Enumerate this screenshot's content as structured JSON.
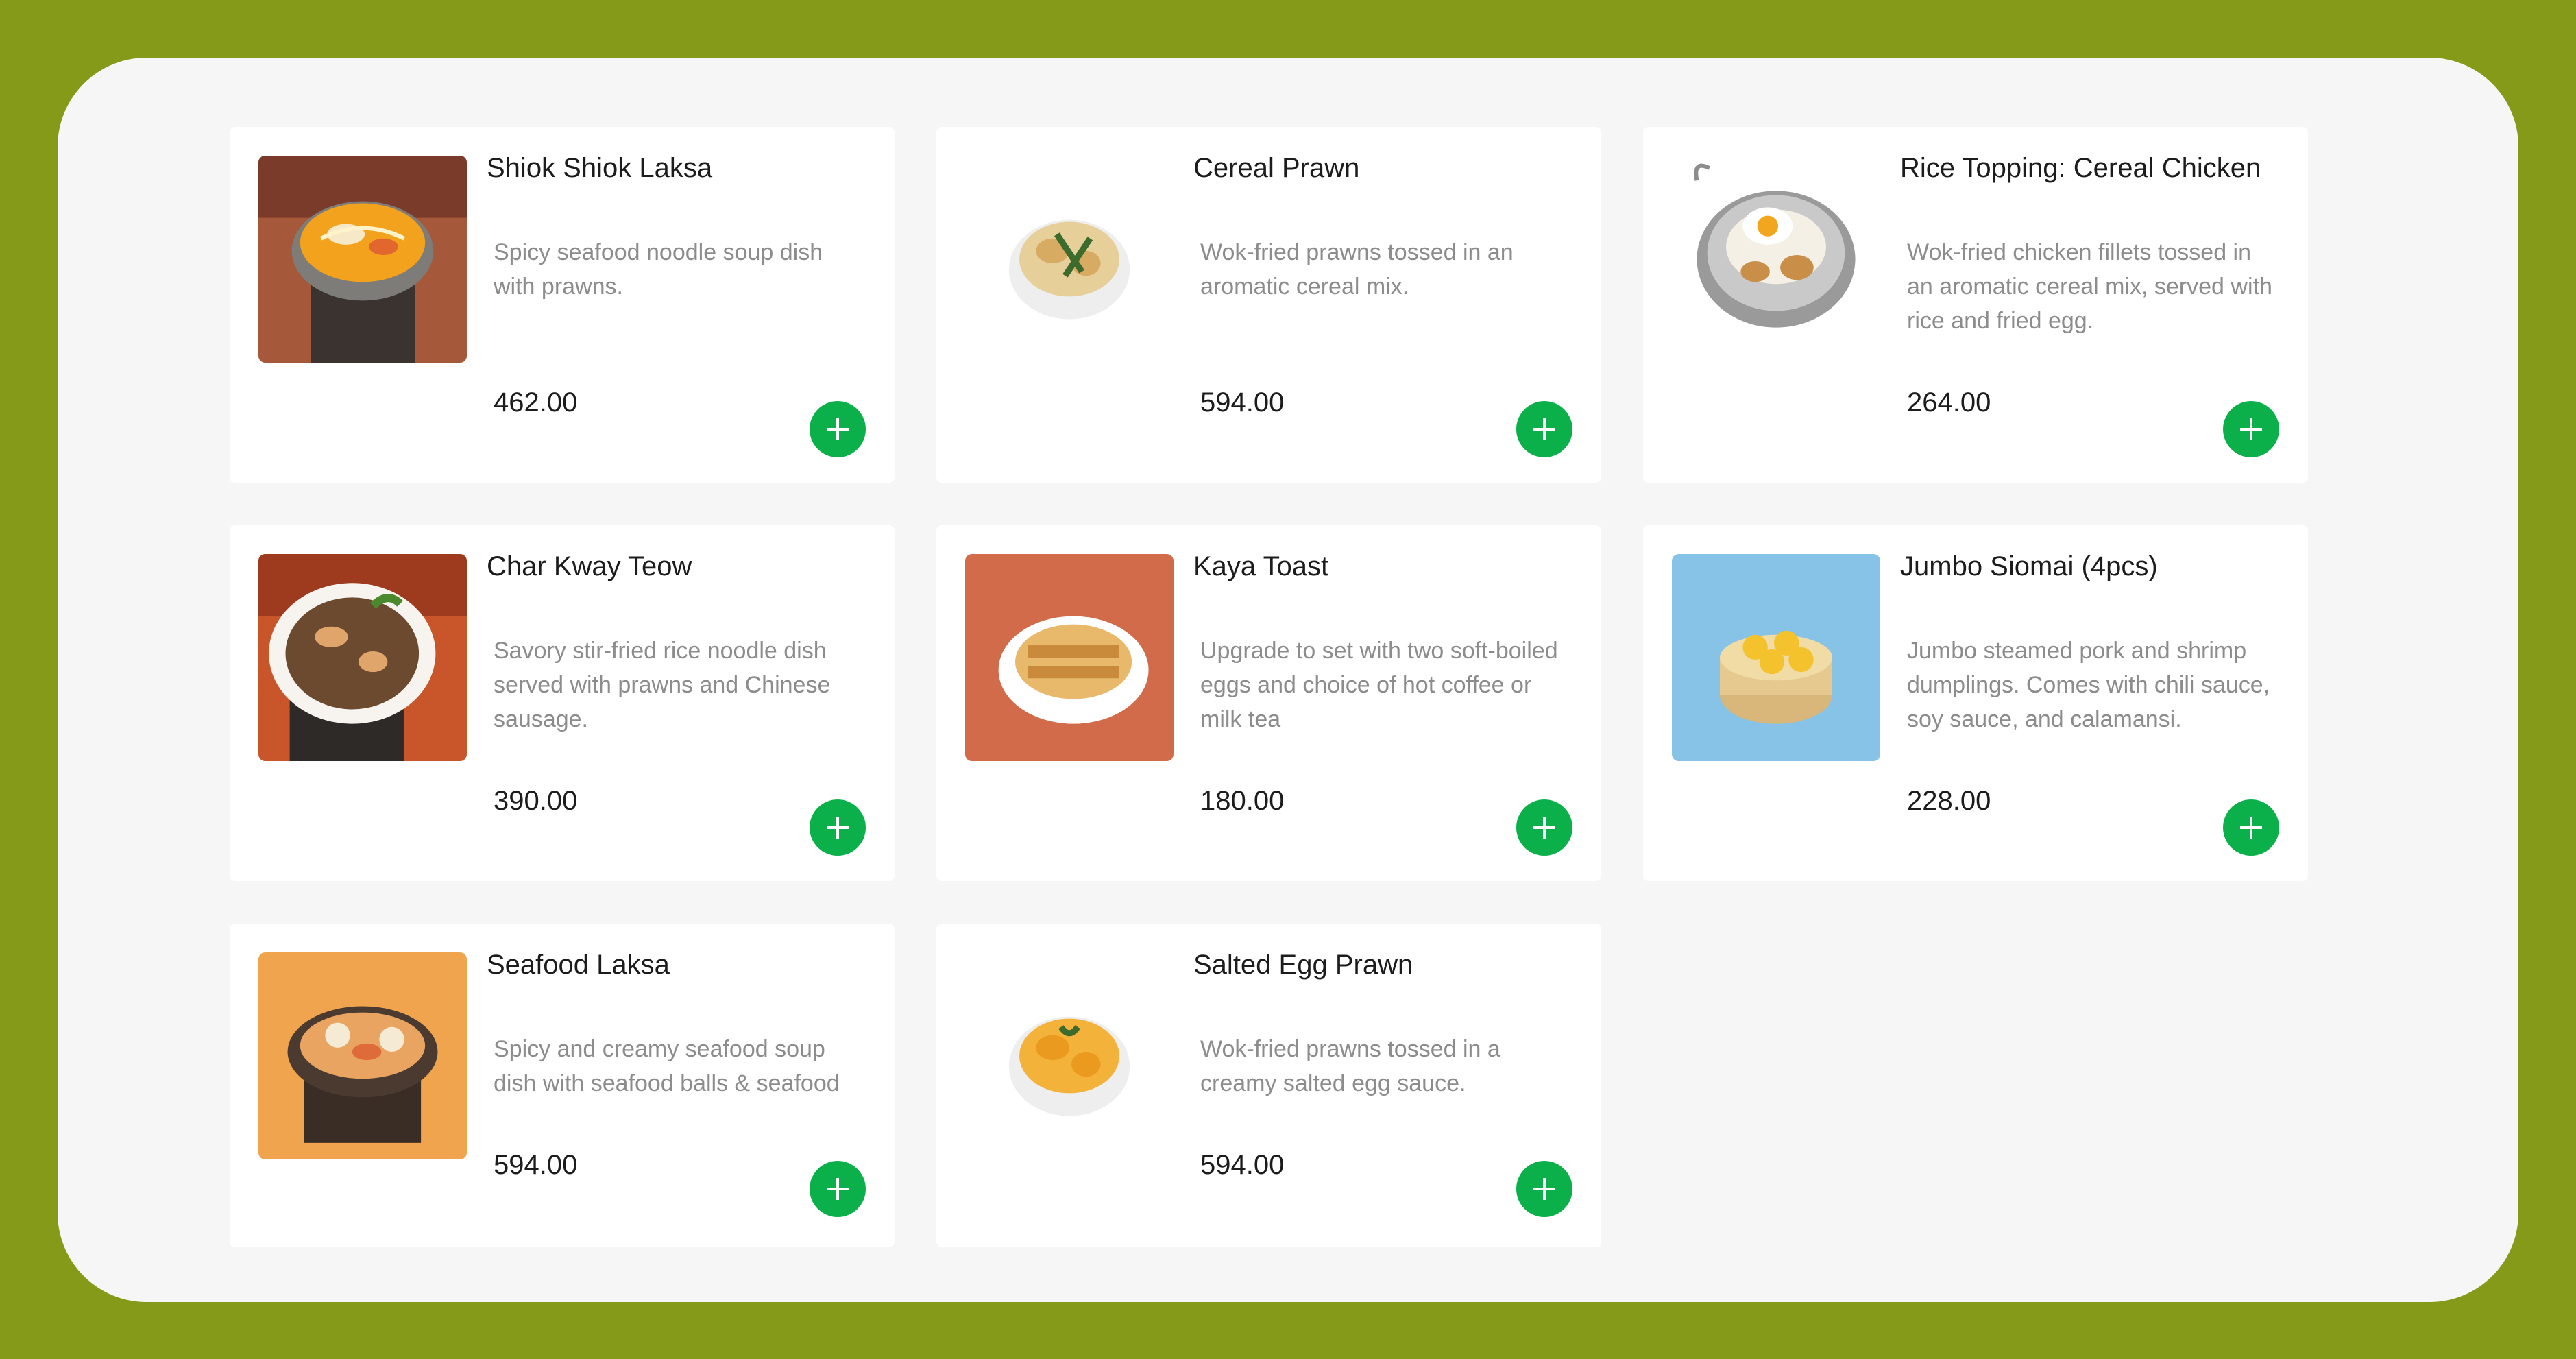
{
  "menu": {
    "items": [
      {
        "name": "Shiok Shiok Laksa",
        "description": "Spicy seafood noodle soup dish with prawns.",
        "price": "462.00"
      },
      {
        "name": "Cereal Prawn",
        "description": "Wok-fried prawns tossed in an aromatic cereal mix.",
        "price": "594.00"
      },
      {
        "name": "Rice Topping: Cereal Chicken",
        "description": "Wok-fried chicken fillets tossed in an aromatic cereal mix, served with rice and fried egg.",
        "price": "264.00"
      },
      {
        "name": "Char Kway Teow",
        "description": "Savory stir-fried rice noodle dish served with prawns and Chinese sausage.",
        "price": "390.00"
      },
      {
        "name": "Kaya Toast",
        "description": "Upgrade to set with two soft-boiled eggs and choice of hot coffee or milk tea",
        "price": "180.00"
      },
      {
        "name": "Jumbo Siomai (4pcs)",
        "description": "Jumbo steamed pork and shrimp dumplings. Comes with chili sauce, soy sauce, and calamansi.",
        "price": "228.00"
      },
      {
        "name": "Seafood Laksa",
        "description": "Spicy and creamy seafood soup dish with seafood balls & seafood",
        "price": "594.00"
      },
      {
        "name": "Salted Egg Prawn",
        "description": "Wok-fried prawns tossed in a creamy salted egg sauce.",
        "price": "594.00"
      }
    ]
  },
  "icons": {
    "add": "plus-icon"
  },
  "colors": {
    "frame": "#869a1a",
    "panel": "#f6f6f6",
    "card": "#ffffff",
    "add_button": "#0bb04a",
    "price_text": "#1c1c1c",
    "description_text": "#8c8c8c"
  }
}
